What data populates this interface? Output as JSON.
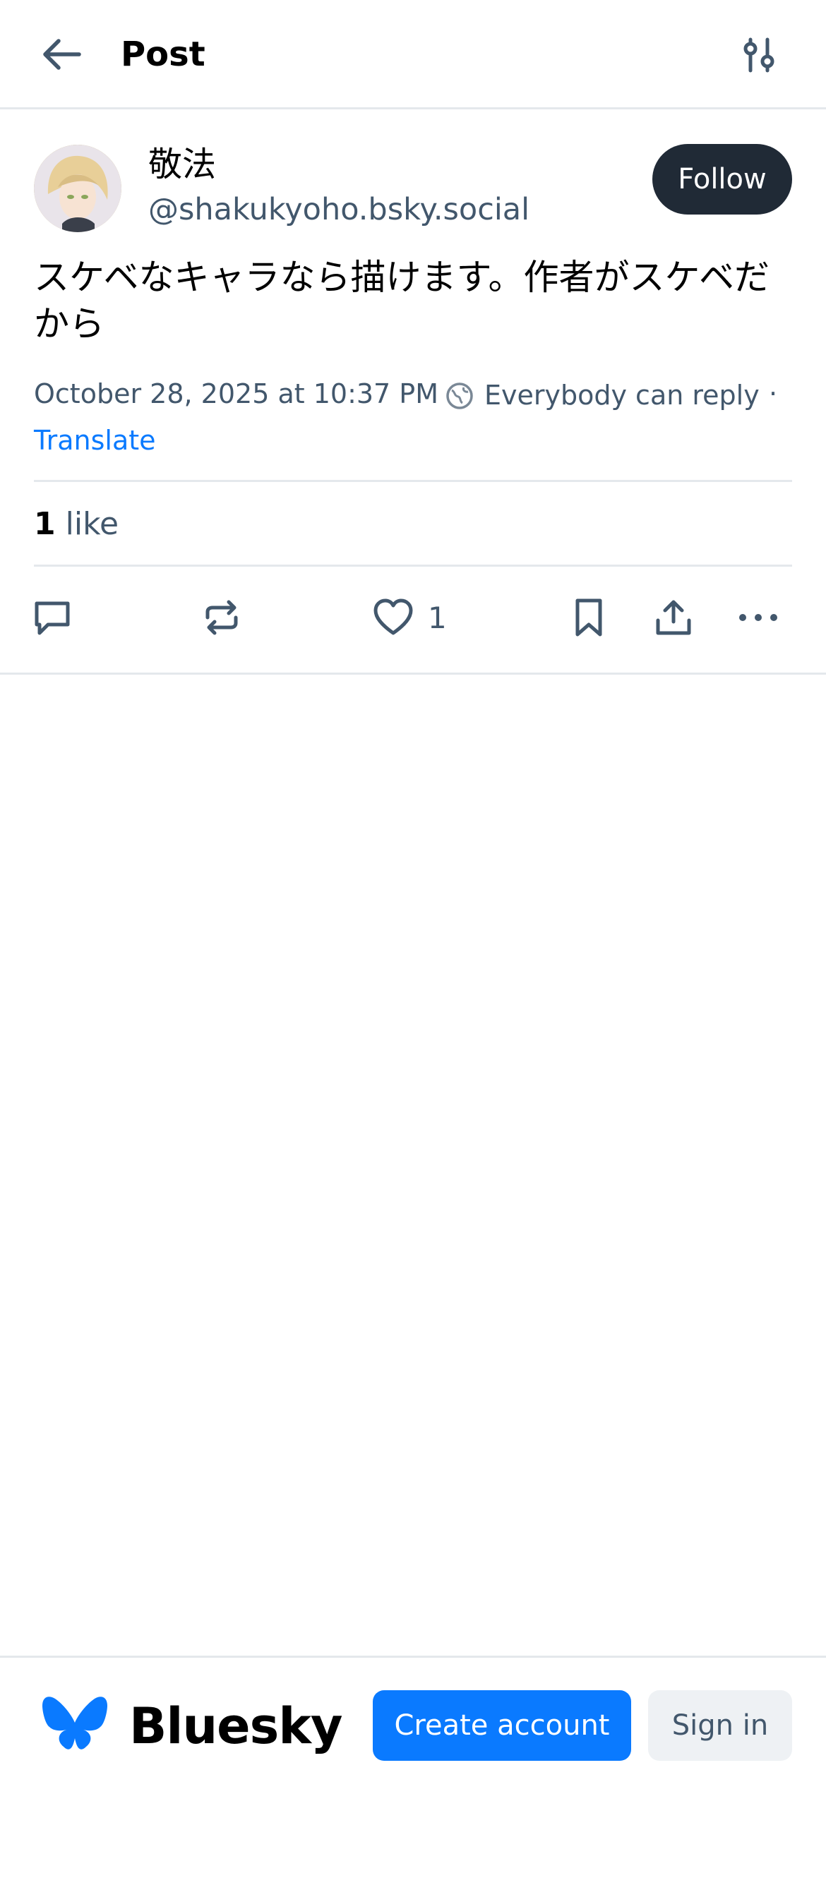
{
  "header": {
    "title": "Post",
    "back_icon": "arrow-left-icon",
    "settings_icon": "sliders-icon"
  },
  "post": {
    "author": {
      "display_name": "敬法",
      "handle": "@shakukyoho.bsky.social",
      "avatar": "avatar-image"
    },
    "follow_label": "Follow",
    "text": "スケベなキャラなら描けます。作者がスケベだから",
    "timestamp": "October 28, 2025 at 10:37 PM",
    "reply_setting": "Everybody can reply",
    "separator": "·",
    "translate_label": "Translate",
    "likes": {
      "count": "1",
      "label": "like"
    },
    "actions": {
      "reply_icon": "comment-icon",
      "repost_icon": "repost-icon",
      "like_icon": "heart-icon",
      "like_count": "1",
      "bookmark_icon": "bookmark-icon",
      "share_icon": "share-icon",
      "more_icon": "more-icon"
    }
  },
  "footer": {
    "brand": "Bluesky",
    "logo_icon": "butterfly-icon",
    "create_account_label": "Create account",
    "sign_in_label": "Sign in"
  },
  "colors": {
    "accent": "#0a7aff",
    "follow_button": "#202a36",
    "secondary_text": "#42576c",
    "divider": "#e4e8ec"
  }
}
